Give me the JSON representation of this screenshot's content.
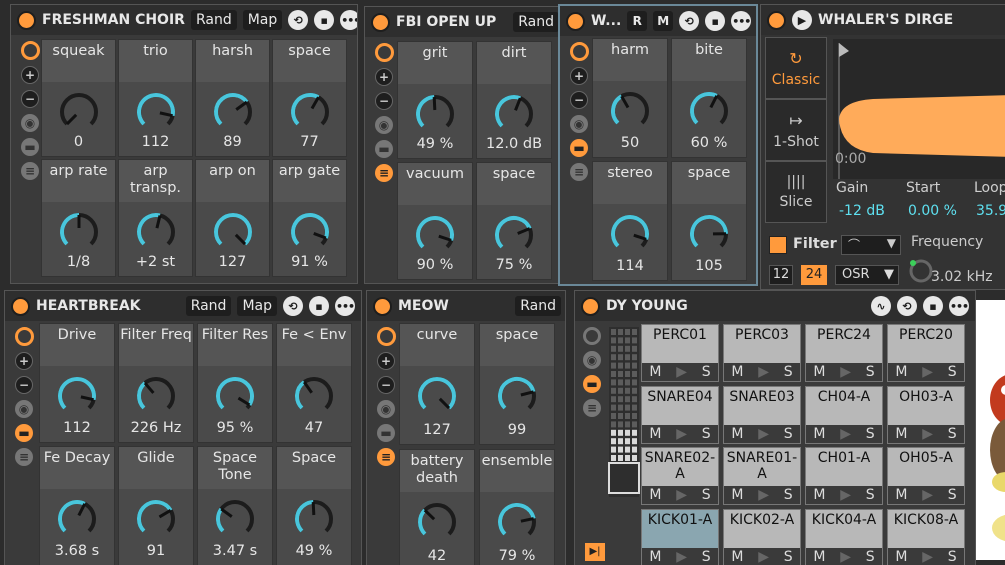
{
  "colors": {
    "accent": "#ff9a3c",
    "knob_arc": "#49c6dc",
    "value_text": "#5ee0f0"
  },
  "freshman": {
    "title": "FRESHMAN CHOIR",
    "rand": "Rand",
    "map": "Map",
    "macros": [
      {
        "label": "squeak",
        "value": "0",
        "fraction": 0.0
      },
      {
        "label": "trio",
        "value": "112",
        "fraction": 0.88
      },
      {
        "label": "harsh",
        "value": "89",
        "fraction": 0.7
      },
      {
        "label": "space",
        "value": "77",
        "fraction": 0.61
      },
      {
        "label": "arp rate",
        "value": "1/8",
        "fraction": 0.5
      },
      {
        "label": "arp transp.",
        "value": "+2 st",
        "fraction": 0.55
      },
      {
        "label": "arp on",
        "value": "127",
        "fraction": 1.0
      },
      {
        "label": "arp gate",
        "value": "91 %",
        "fraction": 0.91
      }
    ]
  },
  "fbi": {
    "title": "FBI OPEN UP",
    "rand": "Rand",
    "macros": [
      {
        "label": "grit",
        "value": "49 %",
        "fraction": 0.49
      },
      {
        "label": "dirt",
        "value": "12.0 dB",
        "fraction": 0.58
      },
      {
        "label": "vacuum",
        "value": "90 %",
        "fraction": 0.9
      },
      {
        "label": "space",
        "value": "75 %",
        "fraction": 0.75
      }
    ]
  },
  "w": {
    "title": "W...",
    "r": "R",
    "m": "M",
    "macros": [
      {
        "label": "harm",
        "value": "50",
        "fraction": 0.39
      },
      {
        "label": "bite",
        "value": "60 %",
        "fraction": 0.6
      },
      {
        "label": "stereo",
        "value": "114",
        "fraction": 0.9
      },
      {
        "label": "space",
        "value": "105",
        "fraction": 0.83
      }
    ]
  },
  "whaler": {
    "title": "WHALER'S DIRGE",
    "tabs": [
      "Classic",
      "1-Shot",
      "Slice"
    ],
    "time": "0:00",
    "gain_label": "Gain",
    "gain_value": "-12 dB",
    "start_label": "Start",
    "start_value": "0.00 %",
    "loop_label": "Loop",
    "loop_value": "35.9",
    "filter_label": "Filter",
    "frequency_label": "Frequency",
    "r_label": "R",
    "slope_12": "12",
    "slope_24": "24",
    "osr": "OSR",
    "freq_value": "3.02 kHz"
  },
  "heartbreak": {
    "title": "HEARTBREAK",
    "rand": "Rand",
    "map": "Map",
    "macros": [
      {
        "label": "Drive",
        "value": "112",
        "fraction": 0.88
      },
      {
        "label": "Filter Freq",
        "value": "226 Hz",
        "fraction": 0.35
      },
      {
        "label": "Filter Res",
        "value": "95 %",
        "fraction": 0.95
      },
      {
        "label": "Fe < Env",
        "value": "47",
        "fraction": 0.37
      },
      {
        "label": "Fe Decay",
        "value": "3.68 s",
        "fraction": 0.6
      },
      {
        "label": "Glide",
        "value": "91",
        "fraction": 0.72
      },
      {
        "label": "Space Tone",
        "value": "3.47 s",
        "fraction": 0.3
      },
      {
        "label": "Space",
        "value": "49 %",
        "fraction": 0.49
      }
    ]
  },
  "meow": {
    "title": "MEOW",
    "rand": "Rand",
    "macros": [
      {
        "label": "curve",
        "value": "127",
        "fraction": 1.0
      },
      {
        "label": "space",
        "value": "99",
        "fraction": 0.78
      },
      {
        "label": "battery death",
        "value": "42",
        "fraction": 0.33
      },
      {
        "label": "ensemble",
        "value": "79 %",
        "fraction": 0.79
      }
    ]
  },
  "dy": {
    "title": "DY YOUNG",
    "pads": [
      [
        "PERC01",
        "PERC03",
        "PERC24",
        "PERC20"
      ],
      [
        "SNARE04",
        "SNARE03",
        "CH04-A",
        "OH03-A"
      ],
      [
        "SNARE02-A",
        "SNARE01-A",
        "CH01-A",
        "OH05-A"
      ],
      [
        "KICK01-A",
        "KICK02-A",
        "KICK04-A",
        "KICK08-A"
      ]
    ],
    "m": "M",
    "s": "S"
  }
}
